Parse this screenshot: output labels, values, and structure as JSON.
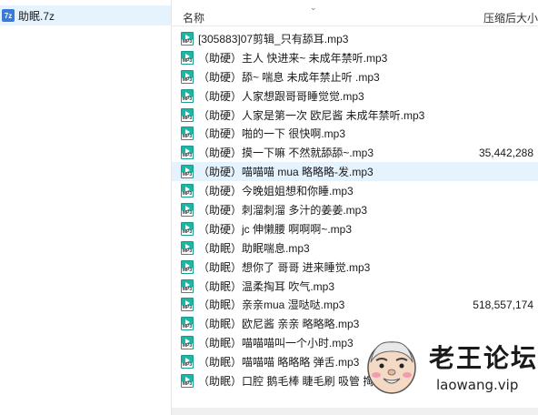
{
  "tree": {
    "archive_label": "助眠.7z",
    "archive_icon": "archive-7z-icon"
  },
  "header": {
    "name_label": "名称",
    "size_label": "压缩后大小",
    "sort_icon": "chevron-down-icon"
  },
  "files": [
    {
      "name": "[305883]07剪辑_只有舔耳.mp3",
      "size": ""
    },
    {
      "name": "（助硬）主人 快进来~ 未成年禁听.mp3",
      "size": ""
    },
    {
      "name": "（助硬）舔~ 喘息 未成年禁止听 .mp3",
      "size": ""
    },
    {
      "name": "（助硬）人家想跟哥哥睡觉觉.mp3",
      "size": ""
    },
    {
      "name": "（助硬）人家是第一次 欧尼酱 未成年禁听.mp3",
      "size": ""
    },
    {
      "name": "（助硬）啪的一下 很快啊.mp3",
      "size": ""
    },
    {
      "name": "（助硬）摸一下嘛 不然就舔舔~.mp3",
      "size": "35,442,288"
    },
    {
      "name": "（助硬）喵喵喵 mua 略略略-发.mp3",
      "size": ""
    },
    {
      "name": "（助硬）今晚姐姐想和你睡.mp3",
      "size": ""
    },
    {
      "name": "（助硬）刺溜刺溜 多汁的姜姜.mp3",
      "size": ""
    },
    {
      "name": "（助硬）jc 伸懒腰 啊啊啊~.mp3",
      "size": ""
    },
    {
      "name": "（助眠）助眠喘息.mp3",
      "size": ""
    },
    {
      "name": "（助眠）想你了 哥哥 进来睡觉.mp3",
      "size": ""
    },
    {
      "name": "（助眠）温柔掏耳 吹气.mp3",
      "size": ""
    },
    {
      "name": "（助眠）亲亲mua 湿哒哒.mp3",
      "size": "518,557,174"
    },
    {
      "name": "（助眠）欧尼酱 亲亲 略略略.mp3",
      "size": ""
    },
    {
      "name": "（助眠）喵喵喵叫一个小时.mp3",
      "size": ""
    },
    {
      "name": "（助眠）喵喵喵 略略略 弹舌.mp3",
      "size": ""
    },
    {
      "name": "（助眠）口腔 鹅毛棒 睫毛刷 吸管 掏耳...",
      "size": ""
    }
  ],
  "selected_index": 7,
  "file_icon": "mp3-file-icon",
  "watermark": {
    "title": "老王论坛",
    "url": "laowang.vip"
  },
  "colors": {
    "selection": "#e5f3ff",
    "mp3_icon": "#1bb6a4"
  }
}
